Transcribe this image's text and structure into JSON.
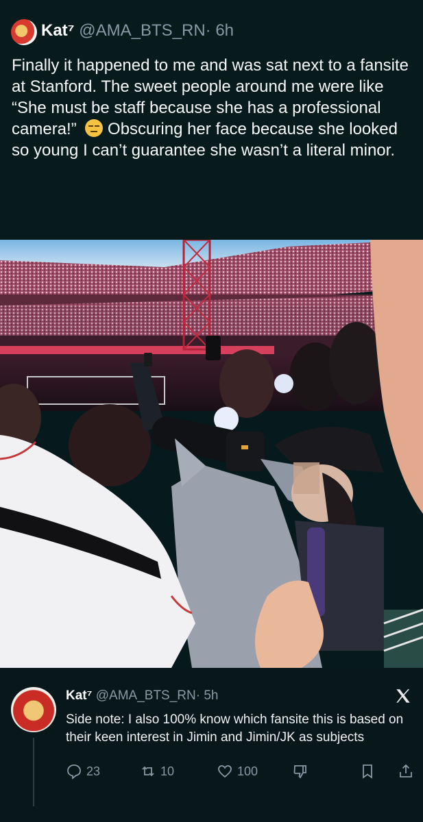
{
  "tweet": {
    "author_name": "Kat⁷",
    "handle": "@AMA_BTS_RN",
    "time": "· 6h",
    "text": "Finally it happened to me and was sat next to a fansite at Stanford. The sweet people around me were like “She must be staff because she has a professional camera!” ",
    "text_after_emoji": "Obscuring her face because she looked so young I can’t guarantee she wasn’t a literal minor.",
    "emoji_icon": "expressionless-face-emoji"
  },
  "reply": {
    "author_name": "Kat⁷",
    "handle": "@AMA_BTS_RN",
    "time": "· 5h",
    "text": "Side note: I also 100% know which fansite this is based on their keen interest in Jimin and Jimin/JK as subjects",
    "actions": {
      "replies": "23",
      "retweets": "10",
      "likes": "100"
    }
  },
  "colors": {
    "background": "#061a1d",
    "text": "#e7e9ea",
    "secondary": "#8b98a5"
  }
}
